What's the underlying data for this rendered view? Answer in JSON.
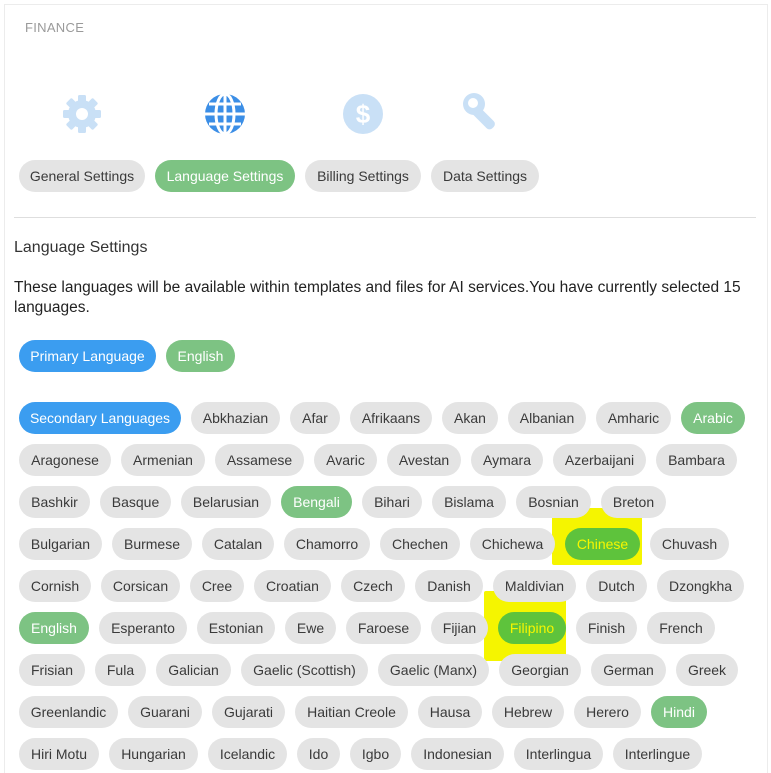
{
  "section_label": "FINANCE",
  "icons": [
    "gear-icon",
    "globe-icon",
    "dollar-icon",
    "wrench-icon"
  ],
  "colors": {
    "primary_blue": "#3b9df0",
    "selected_green": "#7dc383",
    "chip_gray": "#e4e4e4",
    "icon_faded": "#c9e0f6",
    "highlight_yellow": "#f5f500"
  },
  "tabs": [
    "General Settings",
    "Language Settings",
    "Billing Settings",
    "Data Settings"
  ],
  "active_tab": "Language Settings",
  "heading": "Language Settings",
  "description": "These languages will be available within templates and files for AI services.You have currently selected 15 languages.",
  "primary": {
    "label": "Primary Language",
    "value": "English"
  },
  "secondary_label": "Secondary Languages",
  "languages": [
    [
      "Abkhazian",
      "Afar",
      "Afrikaans",
      "Akan",
      "Albanian",
      "Amharic",
      "Arabic"
    ],
    [
      "Aragonese",
      "Armenian",
      "Assamese",
      "Avaric",
      "Avestan",
      "Aymara",
      "Azerbaijani",
      "Bambara"
    ],
    [
      "Bashkir",
      "Basque",
      "Belarusian",
      "Bengali",
      "Bihari",
      "Bislama",
      "Bosnian",
      "Breton"
    ],
    [
      "Bulgarian",
      "Burmese",
      "Catalan",
      "Chamorro",
      "Chechen",
      "Chichewa",
      "Chinese",
      "Chuvash"
    ],
    [
      "Cornish",
      "Corsican",
      "Cree",
      "Croatian",
      "Czech",
      "Danish",
      "Maldivian",
      "Dutch",
      "Dzongkha"
    ],
    [
      "English",
      "Esperanto",
      "Estonian",
      "Ewe",
      "Faroese",
      "Fijian",
      "Filipino",
      "Finish",
      "French"
    ],
    [
      "Frisian",
      "Fula",
      "Galician",
      "Gaelic (Scottish)",
      "Gaelic (Manx)",
      "Georgian",
      "German",
      "Greek"
    ],
    [
      "Greenlandic",
      "Guarani",
      "Gujarati",
      "Haitian Creole",
      "Hausa",
      "Hebrew",
      "Herero",
      "Hindi"
    ],
    [
      "Hiri Motu",
      "Hungarian",
      "Icelandic",
      "Ido",
      "Igbo",
      "Indonesian",
      "Interlingua",
      "Interlingue"
    ]
  ],
  "selected": [
    "Arabic",
    "Bengali",
    "Chinese",
    "English",
    "Filipino",
    "Hindi"
  ],
  "highlighted": [
    "Chinese",
    "Filipino"
  ]
}
